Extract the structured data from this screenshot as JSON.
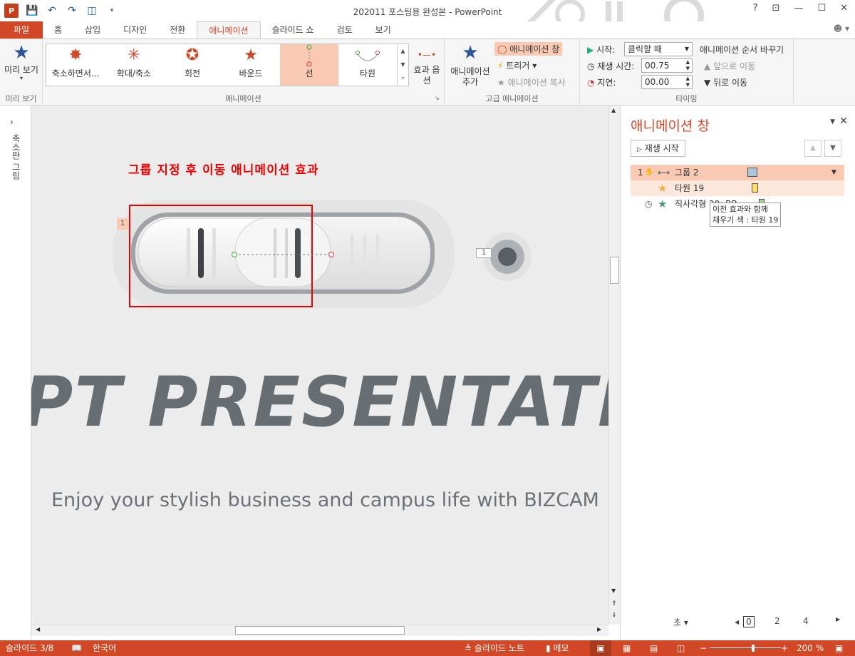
{
  "window": {
    "title": "202011 포스팅용 완성본 - PowerPoint",
    "app_icon": "P"
  },
  "window_controls": {
    "help": "?",
    "restore_ribbon": "⊡",
    "minimize": "—",
    "maximize": "☐",
    "close": "✕"
  },
  "tabs": [
    {
      "label": "파일"
    },
    {
      "label": "홈"
    },
    {
      "label": "삽입"
    },
    {
      "label": "디자인"
    },
    {
      "label": "전환"
    },
    {
      "label": "애니메이션"
    },
    {
      "label": "슬라이드 쇼"
    },
    {
      "label": "검토"
    },
    {
      "label": "보기"
    }
  ],
  "ribbon": {
    "preview": {
      "label": "미리 보기",
      "group_label": "미리 보기"
    },
    "gallery": {
      "items": [
        {
          "label": "축소하면서..."
        },
        {
          "label": "확대/축소"
        },
        {
          "label": "회전"
        },
        {
          "label": "바운드"
        },
        {
          "label": "선"
        },
        {
          "label": "타원"
        }
      ],
      "selected": "선"
    },
    "effect_options": {
      "label": "효과 옵션"
    },
    "animation_group_label": "애니메이션",
    "add_animation": {
      "label": "애니메이션 추가"
    },
    "animation_pane_btn": "애니메이션 창",
    "trigger_btn": "트리거",
    "anim_painter_btn": "애니메이션 복사",
    "advanced_group_label": "고급 애니메이션",
    "start_label": "시작:",
    "start_value": "클릭할 때",
    "duration_label": "재생 시간:",
    "duration_value": "00.75",
    "delay_label": "지연:",
    "delay_value": "00.00",
    "reorder_label": "애니메이션 순서 바꾸기",
    "move_earlier": "앞으로 이동",
    "move_later": "뒤로 이동",
    "timing_group_label": "타이밍"
  },
  "left_pane": {
    "label": "축소판 그림"
  },
  "slide": {
    "red_caption": "그룹 지정 후 이동 애니메이션 효과",
    "tag1": "1",
    "tag2": "1",
    "title": "PT PRESENTATION",
    "subtitle": "Enjoy your stylish business and campus life with BIZCAM"
  },
  "anim_pane": {
    "title": "애니메이션 창",
    "play_btn": "재생 시작",
    "rows": [
      {
        "num": "1",
        "name": "그룹 2"
      },
      {
        "name": "타원 19"
      },
      {
        "name": "직사각형 20: BB"
      }
    ],
    "tooltip_line1": "이전 효과와 함께",
    "tooltip_line2": "채우기 색 : 타원 19",
    "seconds_label": "초",
    "timeline_ticks": [
      "0",
      "2",
      "4"
    ]
  },
  "status": {
    "slide": "슬라이드 3/8",
    "lang": "한국어",
    "notes": "슬라이드 노트",
    "memo": "메모",
    "zoom": "200 %"
  },
  "colors": {
    "accent": "#d24726",
    "gallery_selected": "#f9c9b4",
    "caption_red": "#e00000"
  }
}
